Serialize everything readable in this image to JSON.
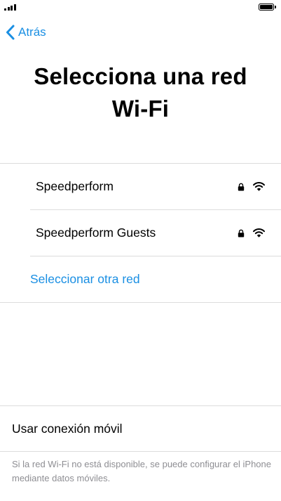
{
  "header": {
    "back_label": "Atrás",
    "title": "Selecciona una red Wi-Fi"
  },
  "networks": [
    {
      "name": "Speedperform",
      "secured": true,
      "signal": "full"
    },
    {
      "name": "Speedperform Guests",
      "secured": true,
      "signal": "full"
    }
  ],
  "other_network_label": "Seleccionar otra red",
  "cellular": {
    "label": "Usar conexión móvil",
    "note": "Si la red Wi-Fi no está disponible, se puede configurar el iPhone mediante datos móviles."
  },
  "icons": {
    "back": "chevron-left-icon",
    "lock": "lock-icon",
    "wifi": "wifi-icon",
    "signal": "cellular-signal-icon",
    "battery": "battery-icon"
  },
  "colors": {
    "accent": "#1a8fe3",
    "separator": "#dcdcdc",
    "secondary_text": "#8e8e93"
  }
}
